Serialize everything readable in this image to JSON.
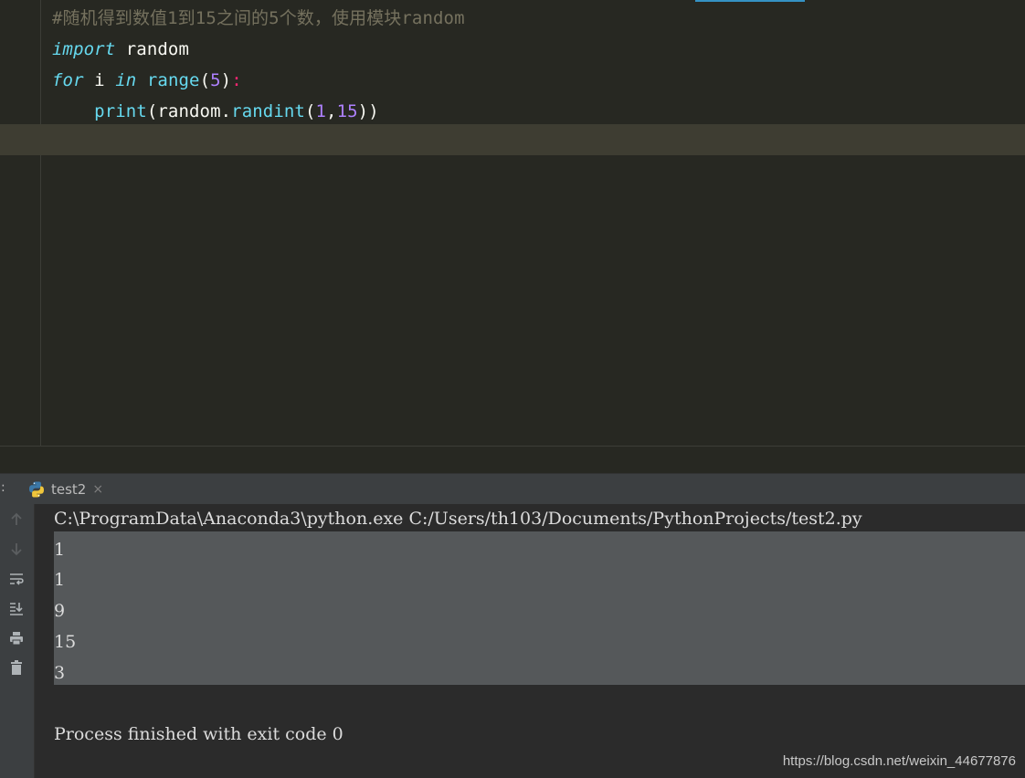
{
  "editor": {
    "lines": [
      {
        "tokens": [
          {
            "t": "#随机得到数值1到15之间的5个数，使用模块random",
            "c": "comment"
          }
        ]
      },
      {
        "tokens": [
          {
            "t": "import",
            "c": "kw"
          },
          {
            "t": " random",
            "c": "plain"
          }
        ]
      },
      {
        "tokens": [
          {
            "t": "for",
            "c": "kw"
          },
          {
            "t": " i ",
            "c": "plain"
          },
          {
            "t": "in",
            "c": "kw"
          },
          {
            "t": " ",
            "c": "plain"
          },
          {
            "t": "range",
            "c": "fn"
          },
          {
            "t": "(",
            "c": "plain"
          },
          {
            "t": "5",
            "c": "num"
          },
          {
            "t": ")",
            "c": "plain"
          },
          {
            "t": ":",
            "c": "punct"
          }
        ]
      },
      {
        "tokens": [
          {
            "t": "    ",
            "c": "plain"
          },
          {
            "t": "print",
            "c": "fn"
          },
          {
            "t": "(random.",
            "c": "plain"
          },
          {
            "t": "randint",
            "c": "fn"
          },
          {
            "t": "(",
            "c": "plain"
          },
          {
            "t": "1",
            "c": "num"
          },
          {
            "t": ",",
            "c": "plain"
          },
          {
            "t": "15",
            "c": "num"
          },
          {
            "t": "))",
            "c": "plain"
          }
        ]
      }
    ]
  },
  "run_panel": {
    "prefix": ":",
    "tab_label": "test2",
    "tab_close": "×",
    "tools": [
      "up-arrow-icon",
      "down-arrow-icon",
      "soft-wrap-icon",
      "scroll-to-end-icon",
      "print-icon",
      "trash-icon"
    ],
    "console": {
      "command": "C:\\ProgramData\\Anaconda3\\python.exe C:/Users/th103/Documents/PythonProjects/test2.py",
      "outputs": [
        "1",
        "1",
        "9",
        "15",
        "3"
      ],
      "blank": "",
      "finish": "Process finished with exit code 0"
    }
  },
  "watermark": "https://blog.csdn.net/weixin_44677876",
  "colors": {
    "editor_bg": "#272822",
    "comment": "#75715e",
    "keyword": "#66d9ef",
    "number": "#ae81ff",
    "punct": "#f92672",
    "selection": "#55585a"
  }
}
